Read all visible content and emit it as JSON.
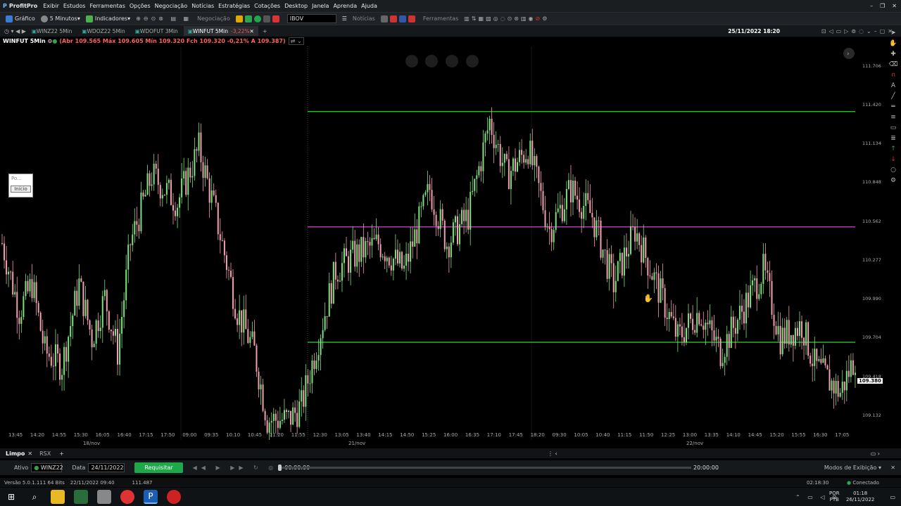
{
  "app": {
    "title": "ProfitPro",
    "menu": [
      "Exibir",
      "Estudos",
      "Ferramentas",
      "Opções",
      "Negociação",
      "Notícias",
      "Estratégias",
      "Cotações",
      "Desktop",
      "Janela",
      "Aprenda",
      "Ajuda"
    ]
  },
  "toolbar": {
    "grafico": "Gráfico",
    "timeframe": "5 Minutos",
    "indicadores": "Indicadores",
    "negociacao": "Negociação",
    "asset_input": "IBOV",
    "noticias": "Notícias",
    "ferramentas": "Ferramentas"
  },
  "tabs": [
    {
      "label": "WINZ22 5Min"
    },
    {
      "label": "WDOZ22 5Min"
    },
    {
      "label": "WDOFUT 3Min"
    },
    {
      "label": "WINFUT 5Min",
      "badge": "-3,22%"
    }
  ],
  "datetime": "25/11/2022 18:20",
  "info": {
    "symbol": "WINFUT 5Min",
    "ohlc": "(Abr 109.565 Máx 109.605 Mín 109.320 Fch 109.320 -0,21% A 109.387)"
  },
  "left_panel": {
    "field_placeholder": "Po...",
    "button": "Início"
  },
  "price_axis": [
    "111.706",
    "111.420",
    "111.134",
    "110.848",
    "110.562",
    "110.277",
    "109.990",
    "109.704",
    "109.418",
    "109.132"
  ],
  "last_price": "109.380",
  "time_axis": [
    "13:45",
    "14:20",
    "14:55",
    "15:30",
    "16:05",
    "16:40",
    "17:15",
    "17:50",
    "09:00",
    "09:35",
    "10:10",
    "10:45",
    "11:20",
    "11:55",
    "12:30",
    "13:05",
    "13:40",
    "14:15",
    "14:50",
    "15:25",
    "16:00",
    "16:35",
    "17:10",
    "17:45",
    "18:20",
    "09:30",
    "10:05",
    "10:40",
    "11:15",
    "11:50",
    "12:25",
    "13:00",
    "13:35",
    "14:10",
    "14:45",
    "15:20",
    "15:55",
    "16:30",
    "17:05"
  ],
  "date_labels": [
    "18/nov",
    "21/nov",
    "22/nov"
  ],
  "chart_data": {
    "type": "candlestick",
    "ylim": [
      108.95,
      111.85
    ],
    "hlines": [
      {
        "y": 111.37,
        "color": "#1ec81e"
      },
      {
        "y": 110.52,
        "color": "#c23bc2"
      },
      {
        "y": 109.67,
        "color": "#3fd03f"
      }
    ],
    "path": [
      [
        0,
        110.4
      ],
      [
        8,
        109.9
      ],
      [
        14,
        110.1
      ],
      [
        20,
        109.6
      ],
      [
        28,
        109.5
      ],
      [
        36,
        110.1
      ],
      [
        42,
        109.7
      ],
      [
        48,
        110.0
      ],
      [
        54,
        109.6
      ],
      [
        60,
        110.4
      ],
      [
        70,
        110.9
      ],
      [
        82,
        110.7
      ],
      [
        92,
        111.1
      ],
      [
        100,
        110.6
      ],
      [
        110,
        109.9
      ],
      [
        118,
        109.6
      ],
      [
        124,
        109.1
      ],
      [
        134,
        109.1
      ],
      [
        140,
        109.2
      ],
      [
        148,
        109.7
      ],
      [
        156,
        110.2
      ],
      [
        164,
        110.3
      ],
      [
        176,
        110.4
      ],
      [
        188,
        110.2
      ],
      [
        200,
        110.8
      ],
      [
        208,
        110.4
      ],
      [
        218,
        110.6
      ],
      [
        228,
        111.3
      ],
      [
        236,
        110.9
      ],
      [
        246,
        111.1
      ],
      [
        256,
        110.5
      ],
      [
        266,
        110.8
      ],
      [
        276,
        110.6
      ],
      [
        286,
        110.1
      ],
      [
        296,
        110.5
      ],
      [
        306,
        110.1
      ],
      [
        316,
        109.7
      ],
      [
        326,
        109.9
      ],
      [
        336,
        109.6
      ],
      [
        346,
        109.9
      ],
      [
        356,
        110.2
      ],
      [
        364,
        109.7
      ],
      [
        374,
        109.8
      ],
      [
        380,
        109.5
      ],
      [
        392,
        109.3
      ],
      [
        400,
        109.6
      ]
    ],
    "n_candles": 400
  },
  "sheet_tabs": [
    "Limpo",
    "RSX"
  ],
  "replay": {
    "ativo_label": "Ativo",
    "asset": "WINZ22",
    "data_label": "Data",
    "date": "24/11/2022",
    "request": "Requisitar",
    "start": "00:00:00",
    "end": "20:00:00",
    "mode": "Modos de Exibição"
  },
  "status": {
    "version": "Versão 5.0.1.111 64 Bits",
    "datetime": "22/11/2022 09:40",
    "value": "111.487",
    "time": "02:18:30",
    "connected": "Conectado"
  },
  "taskbar": {
    "lang": "POR",
    "layout": "PTB",
    "time": "01:18",
    "date": "26/11/2022"
  },
  "colors": {
    "up": "#7ee07e",
    "down": "#f0a0ae",
    "bg": "#000000"
  }
}
